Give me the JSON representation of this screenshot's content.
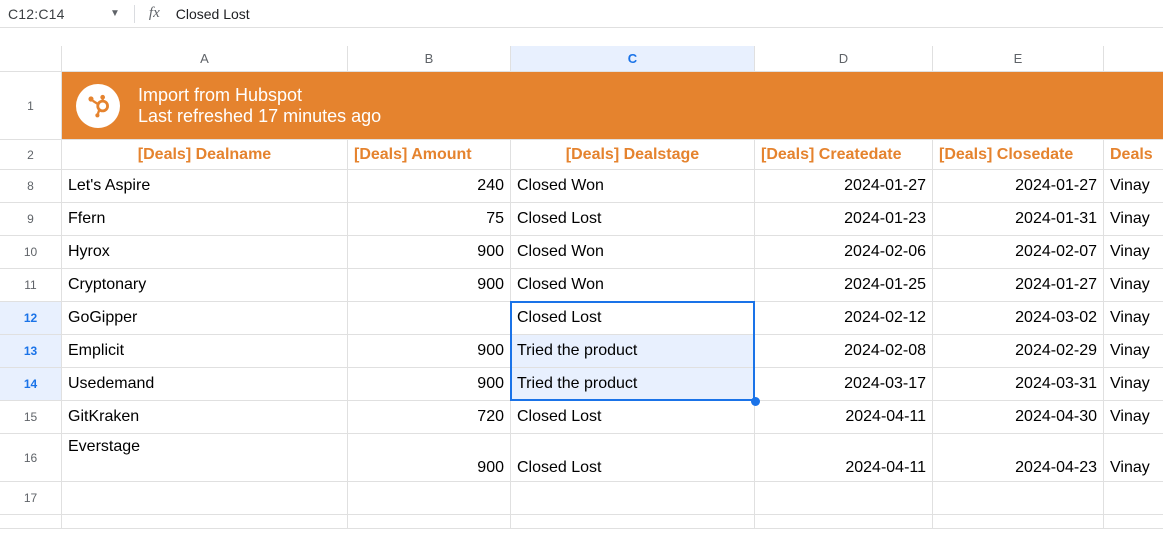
{
  "formula_bar": {
    "name_box": "C12:C14",
    "fx_label": "fx",
    "formula_value": "Closed Lost"
  },
  "col_letters": [
    "A",
    "B",
    "C",
    "D",
    "E",
    ""
  ],
  "banner": {
    "line1": "Import from Hubspot",
    "line2": "Last refreshed 17 minutes ago"
  },
  "headers": {
    "A": "[Deals] Dealname",
    "B": "[Deals] Amount",
    "C": "[Deals] Dealstage",
    "D": "[Deals] Createdate",
    "E": "[Deals] Closedate",
    "F": "Deals"
  },
  "rows": [
    {
      "num": "8",
      "A": "Let's Aspire",
      "B": "240",
      "C": "Closed Won",
      "D": "2024-01-27",
      "E": "2024-01-27",
      "F": "Vinay"
    },
    {
      "num": "9",
      "A": "Ffern",
      "B": "75",
      "C": "Closed Lost",
      "D": "2024-01-23",
      "E": "2024-01-31",
      "F": "Vinay"
    },
    {
      "num": "10",
      "A": "Hyrox",
      "B": "900",
      "C": "Closed Won",
      "D": "2024-02-06",
      "E": "2024-02-07",
      "F": "Vinay"
    },
    {
      "num": "11",
      "A": "Cryptonary",
      "B": "900",
      "C": "Closed Won",
      "D": "2024-01-25",
      "E": "2024-01-27",
      "F": "Vinay"
    },
    {
      "num": "12",
      "A": "GoGipper",
      "B": "",
      "C": "Closed Lost",
      "D": "2024-02-12",
      "E": "2024-03-02",
      "F": "Vinay",
      "sel": true,
      "active": true
    },
    {
      "num": "13",
      "A": "Emplicit",
      "B": "900",
      "C": "Tried the product",
      "D": "2024-02-08",
      "E": "2024-02-29",
      "F": "Vinay",
      "sel": true
    },
    {
      "num": "14",
      "A": "Usedemand",
      "B": "900",
      "C": "Tried the product",
      "D": "2024-03-17",
      "E": "2024-03-31",
      "F": "Vinay",
      "sel": true
    },
    {
      "num": "15",
      "A": "GitKraken",
      "B": "720",
      "C": "Closed Lost",
      "D": "2024-04-11",
      "E": "2024-04-30",
      "F": "Vinay"
    }
  ],
  "tall_row": {
    "num": "16",
    "A": "Everstage",
    "B": "900",
    "C": "Closed Lost",
    "D": "2024-04-11",
    "E": "2024-04-23",
    "F": "Vinay"
  },
  "empty_row": {
    "num": "17"
  }
}
